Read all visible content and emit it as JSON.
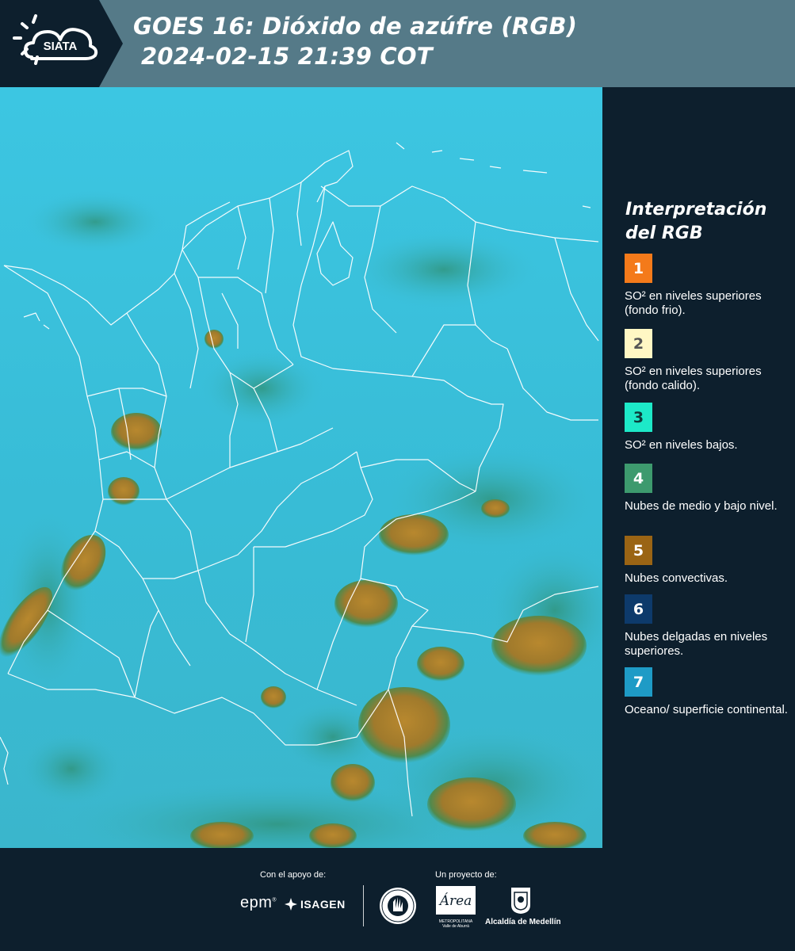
{
  "header": {
    "logo_text": "SIATA",
    "title_line1": "GOES 16: Dióxido de azúfre (RGB)",
    "title_line2": "2024-02-15 21:39 COT"
  },
  "legend": {
    "title_line1": "Interpretación",
    "title_line2": "del RGB",
    "items": [
      {
        "number": "1",
        "color": "#f47a1a",
        "text_color": "#ffffff",
        "label": "SO² en niveles superiores (fondo frio)."
      },
      {
        "number": "2",
        "color": "#fff7c4",
        "text_color": "#555555",
        "label": "SO² en niveles superiores (fondo calido)."
      },
      {
        "number": "3",
        "color": "#1de9c8",
        "text_color": "#0d3b3b",
        "label": "SO² en niveles bajos."
      },
      {
        "number": "4",
        "color": "#3d9a6e",
        "text_color": "#ffffff",
        "label": "Nubes de medio y bajo nivel."
      },
      {
        "number": "5",
        "color": "#9a6414",
        "text_color": "#ffffff",
        "label": "Nubes convectivas."
      },
      {
        "number": "6",
        "color": "#0d3a6b",
        "text_color": "#ffffff",
        "label": "Nubes delgadas en niveles superiores."
      },
      {
        "number": "7",
        "color": "#1e9bc6",
        "text_color": "#ffffff",
        "label": "Oceano/ superficie continental."
      }
    ]
  },
  "footer": {
    "support_label": "Con el apoyo de:",
    "project_label": "Un proyecto de:",
    "epm": "epm",
    "isagen": "ISAGEN",
    "metropolitana": "METROPOLITANA",
    "area": "Área",
    "valle": "Valle de Aburrá",
    "alcaldia": "Alcaldía de Medellín"
  },
  "colors": {
    "header_bg": "#557a88",
    "dark_bg": "#0d1f2d",
    "map_bg": "#3bbfd8",
    "cloud_brown": "#a8812c",
    "cloud_green": "#2f8a6a"
  }
}
